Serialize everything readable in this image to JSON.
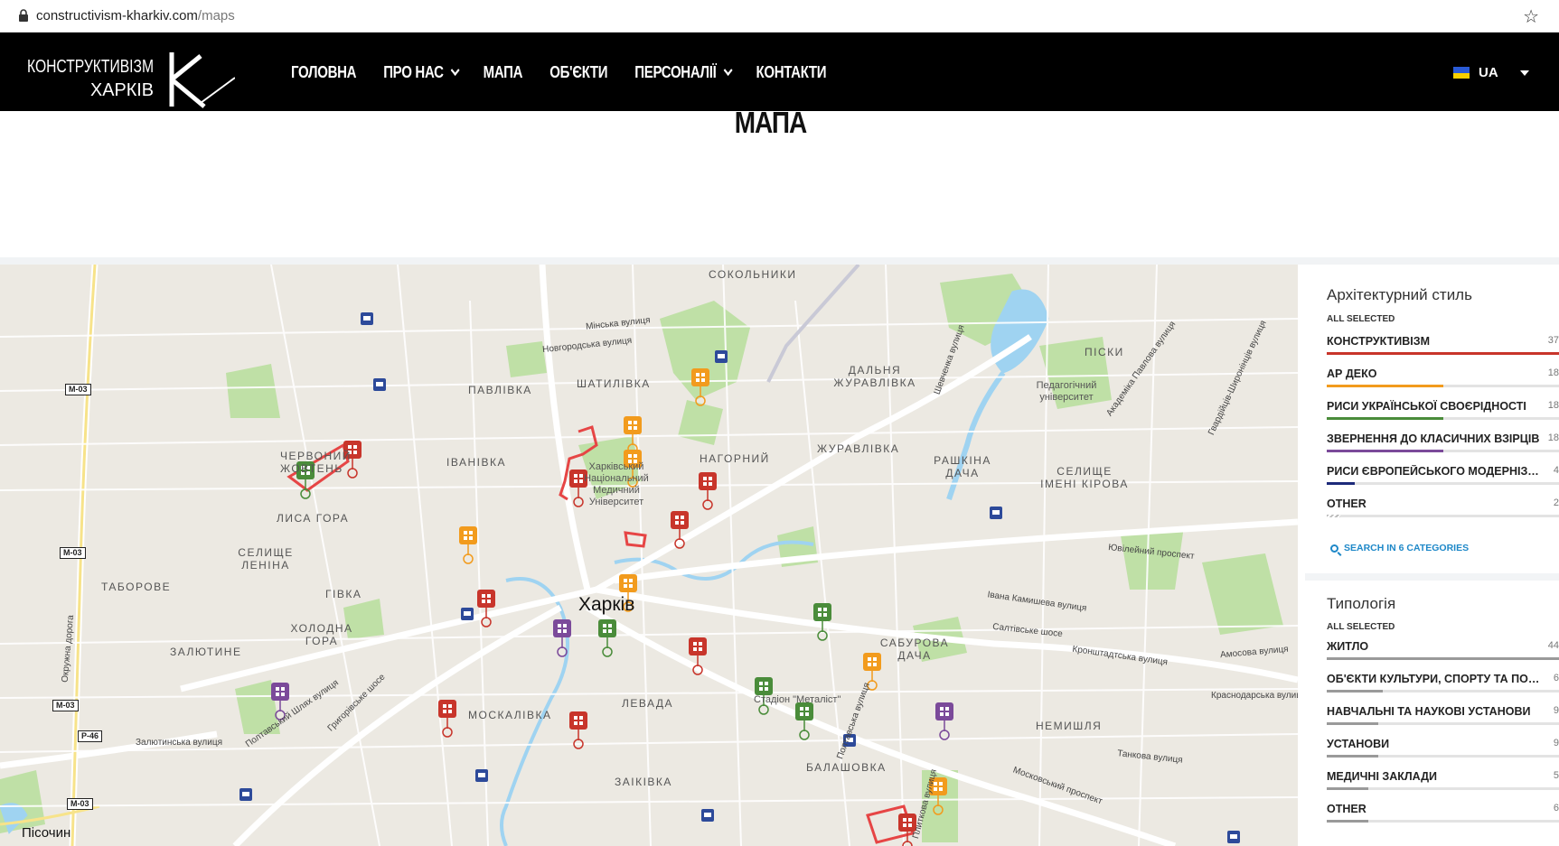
{
  "browser": {
    "url_host": "constructivism-kharkiv.com",
    "url_path": "/maps"
  },
  "nav": {
    "logo_top": "КОНСТРУКТИВІЗМ",
    "logo_bottom": "ХАРКІВ",
    "items": [
      {
        "label": "ГОЛОВНА",
        "has_dropdown": false
      },
      {
        "label": "ПРО НАС",
        "has_dropdown": true
      },
      {
        "label": "МАПА",
        "has_dropdown": false
      },
      {
        "label": "ОБ'ЄКТИ",
        "has_dropdown": false
      },
      {
        "label": "ПЕРСОНАЛІЇ",
        "has_dropdown": true
      },
      {
        "label": "КОНТАКТИ",
        "has_dropdown": false
      }
    ],
    "language": "UA"
  },
  "page": {
    "title": "МАПА"
  },
  "map": {
    "city": "Харків",
    "districts": [
      "СОКОЛЬНИКИ",
      "ПАВЛІВКА",
      "ШАТИЛІВКА",
      "ДАЛЬНЯ ЖУРАВЛІВКА",
      "ПІСКИ",
      "ЧЕРВОНИЙ ЖОВТЕНЬ",
      "ІВАНІВКА",
      "НАГОРНИЙ",
      "ЖУРАВЛІВКА",
      "РАШКІНА ДАЧА",
      "СЕЛИЩЕ ІМЕНІ КІРОВА",
      "ЛИСА ГОРА",
      "СЕЛИЩЕ ЛЕНІНА",
      "ТАБОРОВЕ",
      "ГІВКА",
      "ХОЛОДНА ГОРА",
      "ЗАЛЮТИНЕ",
      "САБУРОВА ДАЧА",
      "НЕМИШЛЯ",
      "МОСКАЛІВКА",
      "ЛЕВАДА",
      "ЗАІКІВКА",
      "БАЛАШОВКА"
    ],
    "streets": [
      "Мінська вулиця",
      "Новгородська вулиця",
      "Шевченка вулиця",
      "Академіка Павлова вулиця",
      "Гвардійців-Широнінців вулиця",
      "Ювілейний проспект",
      "Івана Камишева вулиця",
      "Салтівське шосе",
      "Кронштадтська вулиця",
      "Амосова вулиця",
      "Краснодарська вулиця",
      "Полтавський Шлях вулиця",
      "Григорівське шосе",
      "Залютинська вулиця",
      "Окружна дорога",
      "Полтавська вулиця",
      "Московський проспект",
      "Танкова вулиця",
      "Плиткова вулиця"
    ],
    "roads": [
      "M-03",
      "M-03",
      "M-03",
      "P-46",
      "M-03"
    ],
    "pois": {
      "medical_university": "Харківський Національний Медичний Університет",
      "pedagogical_university": "Педагогічний університет",
      "stadium": "Стадіон \"Металіст\""
    },
    "corner_label": "Пісочин"
  },
  "filters": {
    "style": {
      "title": "Архітектурний стиль",
      "all_selected": "ALL SELECTED",
      "categories": [
        {
          "label": "КОНСТРУКТИВІЗМ",
          "count": "37",
          "color": "#c8352b",
          "fill": 1.0
        },
        {
          "label": "АР ДЕКО",
          "count": "18",
          "color": "#f29b1d",
          "fill": 0.5
        },
        {
          "label": "РИСИ УКРАЇНСЬКОЇ СВОЄРІДНОСТІ",
          "count": "18",
          "color": "#4a8c3a",
          "fill": 0.5
        },
        {
          "label": "ЗВЕРНЕННЯ ДО КЛАСИЧНИХ ВЗІРЦІВ",
          "count": "18",
          "color": "#7b4a9a",
          "fill": 0.5
        },
        {
          "label": "РИСИ ЄВРОПЕЙСЬКОГО МОДЕРНІЗМУ",
          "count": "4",
          "color": "#1d2a7a",
          "fill": 0.12
        },
        {
          "label": "OTHER",
          "count": "2",
          "color": "#bbbbbb",
          "fill": 0.06
        }
      ],
      "search_label": "SEARCH IN 6 CATEGORIES"
    },
    "typology": {
      "title": "Типологія",
      "all_selected": "ALL SELECTED",
      "categories": [
        {
          "label": "ЖИТЛО",
          "count": "44",
          "color": "#9a9a9a",
          "fill": 1.0
        },
        {
          "label": "ОБ'ЄКТИ КУЛЬТУРИ, СПОРТУ ТА ПОБУ...",
          "count": "6",
          "color": "#9a9a9a",
          "fill": 0.24
        },
        {
          "label": "НАВЧАЛЬНІ ТА НАУКОВІ УСТАНОВИ",
          "count": "9",
          "color": "#9a9a9a",
          "fill": 0.22
        },
        {
          "label": "УСТАНОВИ",
          "count": "9",
          "color": "#9a9a9a",
          "fill": 0.22
        },
        {
          "label": "МЕДИЧНІ ЗАКЛАДИ",
          "count": "5",
          "color": "#9a9a9a",
          "fill": 0.18
        },
        {
          "label": "OTHER",
          "count": "6",
          "color": "#9a9a9a",
          "fill": 0.18
        }
      ]
    }
  }
}
